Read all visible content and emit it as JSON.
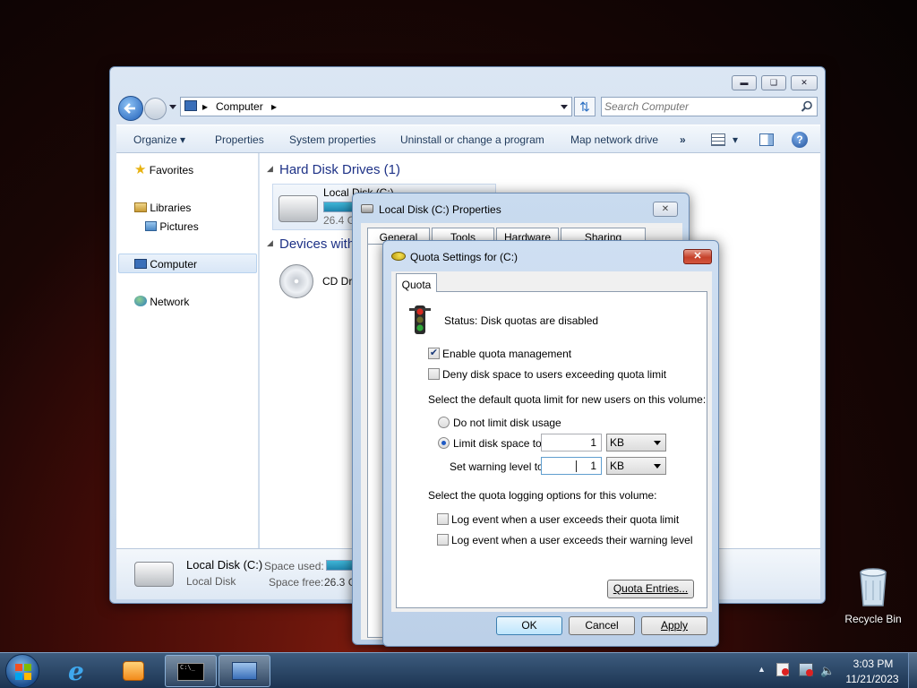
{
  "explorer": {
    "address_path": "Computer",
    "search_placeholder": "Search Computer",
    "toolbar": {
      "organize": "Organize",
      "properties": "Properties",
      "system_properties": "System properties",
      "uninstall": "Uninstall or change a program",
      "map_drive": "Map network drive",
      "more": "»"
    },
    "nav": {
      "favorites": "Favorites",
      "libraries": "Libraries",
      "pictures": "Pictures",
      "computer": "Computer",
      "network": "Network"
    },
    "groups": {
      "hdd": "Hard Disk Drives (1)",
      "devices": "Devices with"
    },
    "hdd_item": {
      "name": "Local Disk (C:)",
      "size": "26.4 G"
    },
    "cd_item": {
      "name": "CD Dr"
    },
    "status": {
      "name": "Local Disk (C:)",
      "type": "Local Disk",
      "space_used_label": "Space used:",
      "space_free_label": "Space free:",
      "space_free_value": "26.3 G"
    }
  },
  "props_dialog": {
    "title": "Local Disk (C:) Properties",
    "tabs": [
      "General",
      "Tools",
      "Hardware",
      "Sharing"
    ]
  },
  "quota_dialog": {
    "title": "Quota Settings for  (C:)",
    "tab": "Quota",
    "status": "Status:  Disk quotas are disabled",
    "enable": "Enable quota management",
    "deny": "Deny disk space to users exceeding quota limit",
    "default_limit_heading": "Select the default quota limit for new users on this volume:",
    "no_limit": "Do not limit disk usage",
    "limit_label": "Limit disk space to",
    "limit_value": "1",
    "limit_unit": "KB",
    "warning_label": "Set warning level to",
    "warning_value": "1",
    "warning_unit": "KB",
    "logging_heading": "Select the quota logging options for this volume:",
    "log_limit": "Log event when a user exceeds their quota limit",
    "log_warning": "Log event when a user exceeds their warning level",
    "entries_btn": "Quota Entries...",
    "ok": "OK",
    "cancel": "Cancel",
    "apply": "Apply"
  },
  "desktop": {
    "recycle_bin": "Recycle Bin"
  },
  "taskbar": {
    "time": "3:03 PM",
    "date": "11/21/2023"
  }
}
